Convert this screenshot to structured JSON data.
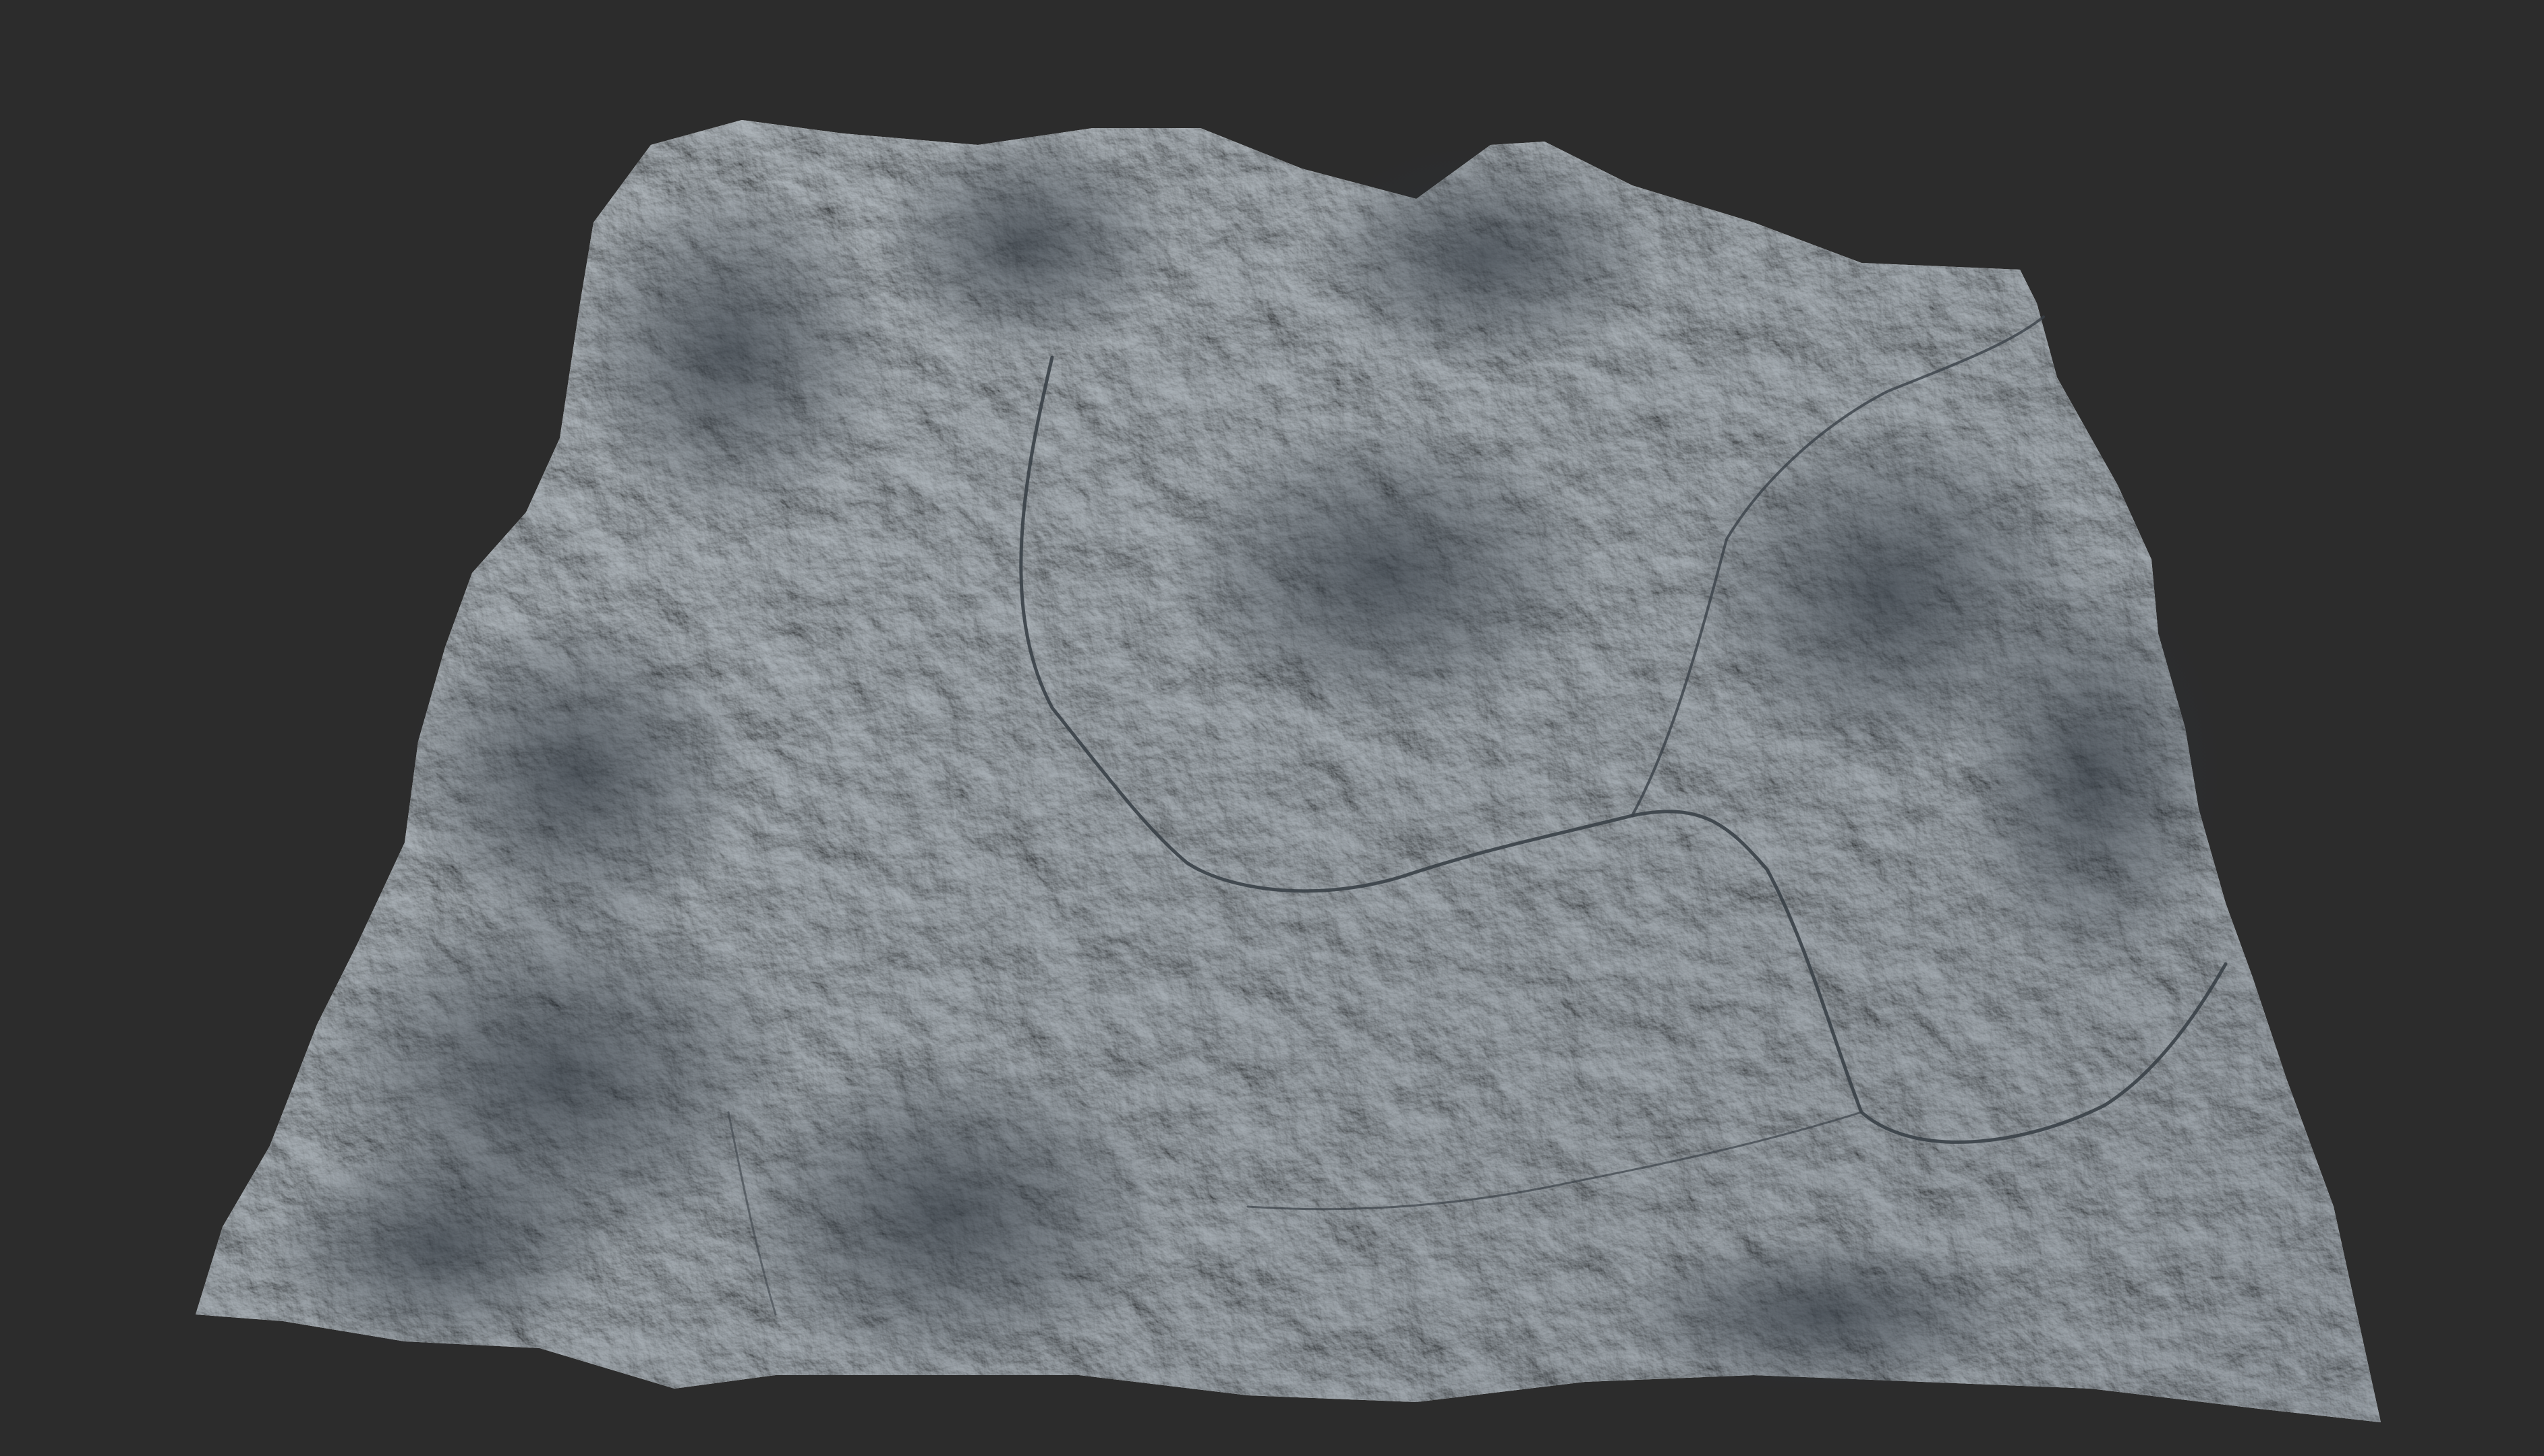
{
  "scene": {
    "subject": "terrain-heightmap-render",
    "colors": {
      "background": "#2c2c2c",
      "terrain_light": "#c9ced2",
      "terrain_mid": "#8f969c",
      "terrain_shadow": "#2b323a",
      "river": "#3a4148"
    }
  }
}
